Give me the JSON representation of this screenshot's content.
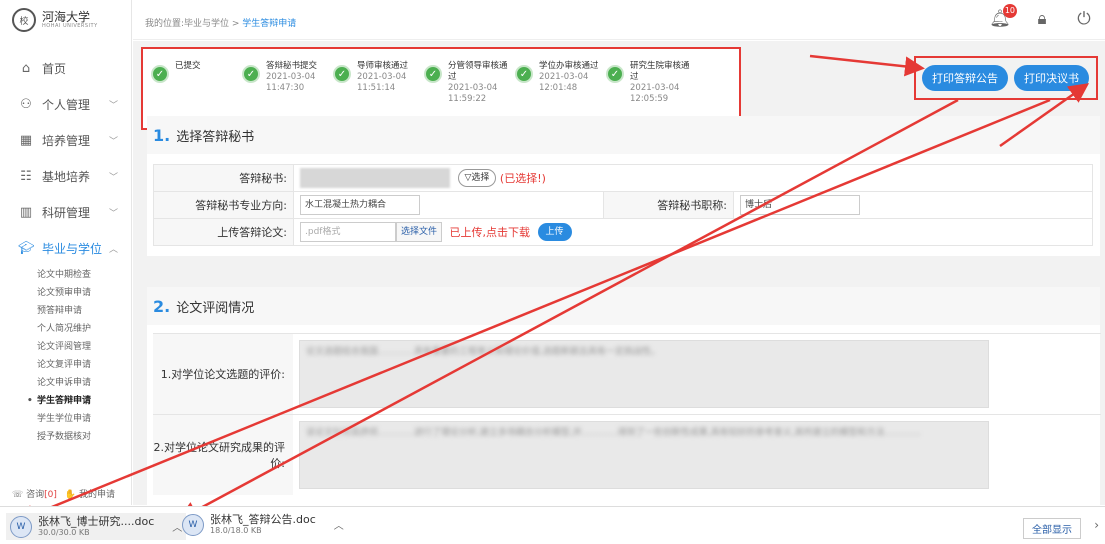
{
  "logo": {
    "text": "河海大学",
    "sub": "HOHAI UNIVERSITY"
  },
  "breadcrumb": {
    "prefix": "我的位置:毕业与学位 > ",
    "current": "学生答辩申请"
  },
  "header": {
    "badge": "10"
  },
  "nav": {
    "home": "首页",
    "personal": "个人管理",
    "training": "培养管理",
    "base": "基地培养",
    "research": "科研管理",
    "graduation": "毕业与学位"
  },
  "sub_items": [
    "论文中期检查",
    "论文预审申请",
    "预答辩申请",
    "个人简况维护",
    "论文评阅管理",
    "论文复评申请",
    "论文申诉申请",
    "学生答辩申请",
    "学生学位申请",
    "授予数据核对"
  ],
  "sidebar_foot": {
    "consult": "咨询",
    "consult_count": "[0]",
    "my_apply": "我的申请"
  },
  "steps": [
    {
      "name": "已提交",
      "time": ""
    },
    {
      "name": "答辩秘书提交",
      "time": "2021-03-04 11:47:30"
    },
    {
      "name": "导师审核通过",
      "time": "2021-03-04 11:51:14"
    },
    {
      "name": "分管领导审核通过",
      "time": "2021-03-04 11:59:22"
    },
    {
      "name": "学位办审核通过",
      "time": "2021-03-04 12:01:48"
    },
    {
      "name": "研究生院审核通过",
      "time": "2021-03-04 12:05:59"
    }
  ],
  "buttons": {
    "print_notice": "打印答辩公告",
    "print_resolution": "打印决议书"
  },
  "section1": {
    "num": "1.",
    "title": "选择答辩秘书",
    "secretary_label": "答辩秘书:",
    "select_btn": "▽选择",
    "selected_text": "(已选择!)",
    "major_label": "答辩秘书专业方向:",
    "major_value": "水工混凝土热力耦合",
    "title_label": "答辩秘书职称:",
    "title_value": "博士后",
    "upload_label": "上传答辩论文:",
    "file_placeholder": ".pdf格式",
    "choose_file": "选择文件",
    "uploaded_text": "已上传,点击下载",
    "upload_btn": "上传"
  },
  "section2": {
    "num": "2.",
    "title": "论文评阅情况",
    "q1_label": "1.对学位论文选题的评价:",
    "q1_text": "论文选题结合我国…………具有重要的工程意义和理论价值,选题新颖且具有一定挑战性。",
    "q2_label": "2.对学位论文研究成果的评价:",
    "q2_text": "该论文针对高拱坝…………进行了理论分析,建立多场耦合分析模型,并…………得到了一些创新性成果,具有较好的参考意义,其所建立的模型和方法…………"
  },
  "downloads": [
    {
      "name": "张林飞_博士研究....doc",
      "size": "30.0/30.0 KB"
    },
    {
      "name": "张林飞_答辩公告.doc",
      "size": "18.0/18.0 KB"
    }
  ],
  "download_bar": {
    "show_all": "全部显示"
  }
}
